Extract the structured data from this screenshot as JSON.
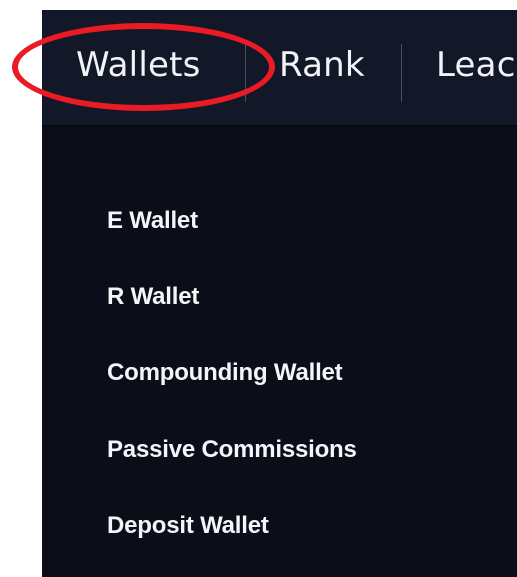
{
  "navbar": {
    "items": [
      {
        "label": "Wallets"
      },
      {
        "label": "Rank"
      },
      {
        "label": "Leac"
      }
    ]
  },
  "wallets_menu": {
    "items": [
      {
        "label": "E Wallet"
      },
      {
        "label": "R Wallet"
      },
      {
        "label": "Compounding Wallet"
      },
      {
        "label": "Passive Commissions"
      },
      {
        "label": "Deposit Wallet"
      }
    ]
  },
  "annotation": {
    "shape": "ellipse",
    "color": "#ea1b24",
    "target": "Wallets"
  },
  "colors": {
    "panel_background": "#0b0e19",
    "navbar_background": "#121828",
    "text": "#f2f3f6"
  }
}
